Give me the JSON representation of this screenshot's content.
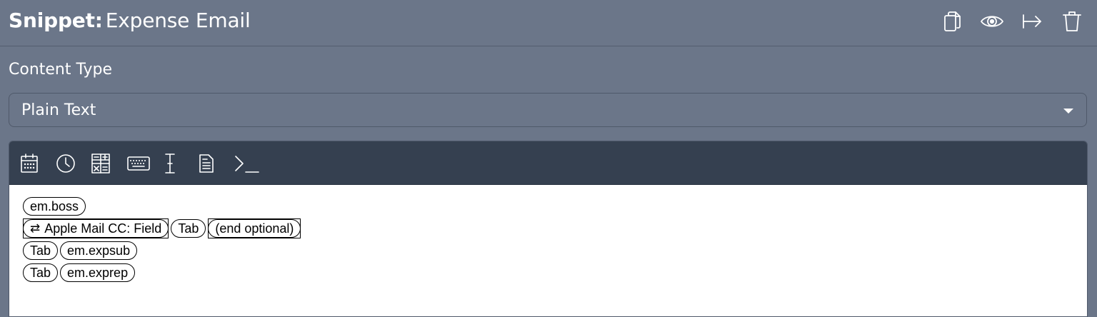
{
  "header": {
    "prefix": "Snippet:",
    "name": "Expense Email",
    "actions": [
      {
        "id": "copy",
        "icon": "copy-icon"
      },
      {
        "id": "preview",
        "icon": "eye-icon"
      },
      {
        "id": "export",
        "icon": "move-right-icon"
      },
      {
        "id": "delete",
        "icon": "trash-icon"
      }
    ]
  },
  "content_type": {
    "label": "Content Type",
    "selected": "Plain Text"
  },
  "toolbar": {
    "icons": [
      "calendar-icon",
      "clock-icon",
      "calculator-icon",
      "keyboard-icon",
      "text-cursor-icon",
      "document-icon",
      "terminal-icon"
    ]
  },
  "editor": {
    "line1": {
      "tag": "em.boss"
    },
    "line2": {
      "repeat_icon": "⇄",
      "field": "Apple Mail CC: Field",
      "tab": "Tab",
      "end": "(end optional)"
    },
    "line3": {
      "tab": "Tab",
      "tag": "em.expsub"
    },
    "line4": {
      "tab": "Tab",
      "tag": "em.exprep"
    }
  }
}
